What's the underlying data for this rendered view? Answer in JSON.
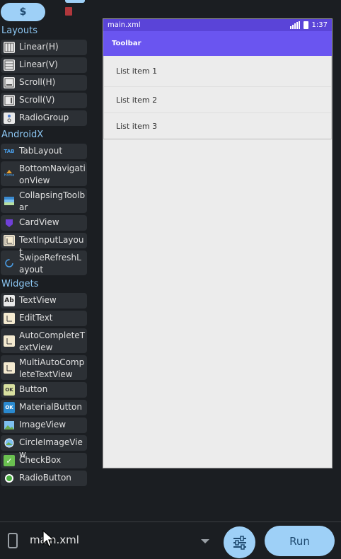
{
  "tabs": {
    "active_label": "$",
    "second_icon": "book-icon"
  },
  "palette": {
    "categories": [
      {
        "title": "Layouts",
        "items": [
          {
            "label": "Linear(H)",
            "icon": "linear-h-icon"
          },
          {
            "label": "Linear(V)",
            "icon": "linear-v-icon"
          },
          {
            "label": "Scroll(H)",
            "icon": "scroll-h-icon"
          },
          {
            "label": "Scroll(V)",
            "icon": "scroll-v-icon"
          },
          {
            "label": "RadioGroup",
            "icon": "radiogroup-icon"
          }
        ]
      },
      {
        "title": "AndroidX",
        "items": [
          {
            "label": "TabLayout",
            "icon": "tablayout-icon",
            "icon_text": "TAB"
          },
          {
            "label": "BottomNavigationView",
            "icon": "bottomnav-icon",
            "icon_text": "Home"
          },
          {
            "label": "CollapsingToolbar",
            "icon": "collapsing-toolbar-icon"
          },
          {
            "label": "CardView",
            "icon": "cardview-icon"
          },
          {
            "label": "TextInputLayout",
            "icon": "textinputlayout-icon"
          },
          {
            "label": "SwipeRefreshLayout",
            "icon": "swiperefresh-icon"
          }
        ]
      },
      {
        "title": "Widgets",
        "items": [
          {
            "label": "TextView",
            "icon": "textview-icon",
            "icon_text": "Ab"
          },
          {
            "label": "EditText",
            "icon": "edittext-icon"
          },
          {
            "label": "AutoCompleteTextView",
            "icon": "autocomplete-icon"
          },
          {
            "label": "MultiAutoCompleteTextView",
            "icon": "multiautocomplete-icon"
          },
          {
            "label": "Button",
            "icon": "button-icon",
            "icon_text": "OK"
          },
          {
            "label": "MaterialButton",
            "icon": "materialbutton-icon",
            "icon_text": "OK"
          },
          {
            "label": "ImageView",
            "icon": "imageview-icon"
          },
          {
            "label": "CircleImageView",
            "icon": "circleimageview-icon"
          },
          {
            "label": "CheckBox",
            "icon": "checkbox-icon",
            "icon_text": "✓"
          },
          {
            "label": "RadioButton",
            "icon": "radiobutton-icon"
          }
        ]
      }
    ]
  },
  "preview": {
    "filename": "main.xml",
    "time": "1:37",
    "toolbar_title": "Toolbar",
    "list_items": [
      "List item 1",
      "List item 2",
      "List item 3"
    ]
  },
  "bottom": {
    "filename": "main.xml",
    "run_label": "Run"
  },
  "colors": {
    "accent": "#9ed0f7",
    "toolbar": "#6a55f0",
    "statusbar": "#5a44d8",
    "background": "#1b1e22"
  }
}
